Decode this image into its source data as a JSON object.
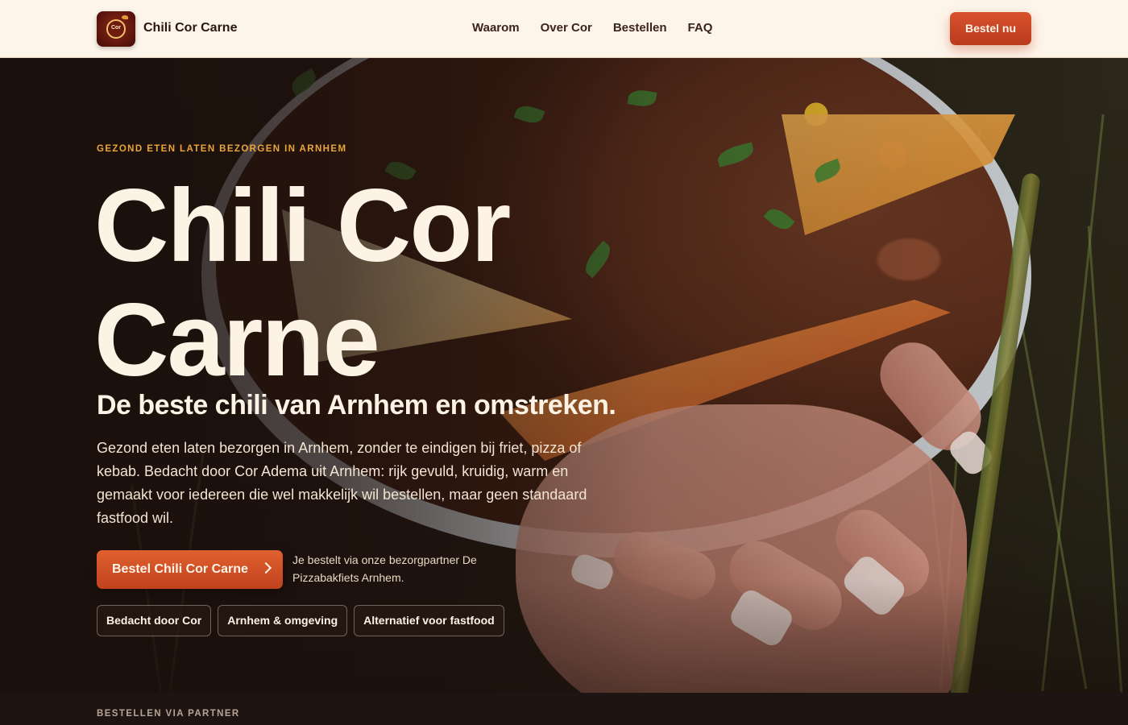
{
  "header": {
    "brand": "Chili Cor Carne",
    "logo_text": "Cor",
    "nav": [
      "Waarom",
      "Over Cor",
      "Bestellen",
      "FAQ"
    ],
    "cta_label": "Bestel nu"
  },
  "hero": {
    "eyebrow": "GEZOND ETEN LATEN BEZORGEN IN ARNHEM",
    "title": "Chili Cor Carne",
    "subtitle": "De beste chili van Arnhem en omstreken.",
    "description": "Gezond eten laten bezorgen in Arnhem, zonder te eindigen bij friet, pizza of kebab. Bedacht door Cor Adema uit Arnhem: rijk gevuld, kruidig, warm en gemaakt voor iedereen die wel makkelijk wil bestellen, maar geen standaard fastfood wil.",
    "cta_label": "Bestel Chili Cor Carne",
    "cta_note": "Je bestelt via onze bezorgpartner De Pizzabakfiets Arnhem.",
    "tags": [
      "Bedacht door Cor",
      "Arnhem & omgeving",
      "Alternatief voor fastfood"
    ]
  },
  "next_section": {
    "label": "BESTELLEN VIA PARTNER"
  },
  "colors": {
    "accent": "#d9522c",
    "eyebrow": "#e9a63a",
    "header_bg": "#fdf5ea",
    "hero_text": "#fdf3e4"
  },
  "icons": {
    "cta": "chevron-right-icon"
  }
}
